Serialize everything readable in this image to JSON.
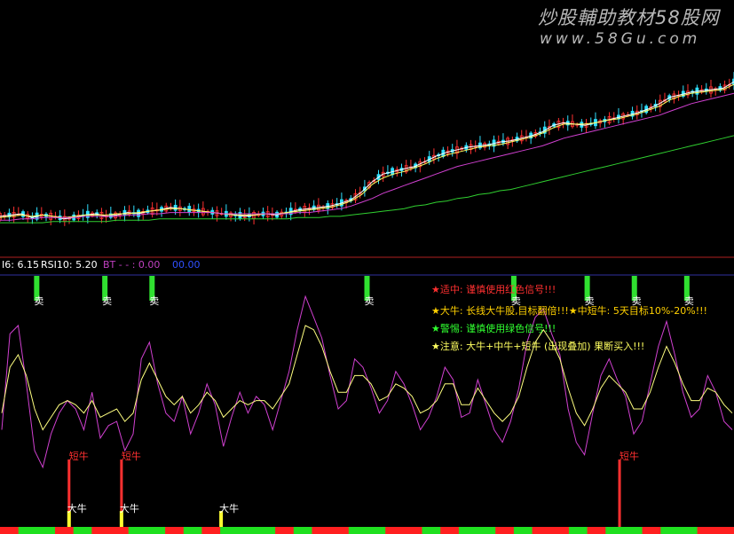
{
  "watermark": {
    "title": "炒股輔助教材58股网",
    "url": "www.58Gu.com"
  },
  "indicator_bar": {
    "segments": [
      {
        "text": "I6: 6.15",
        "color": "#ffffff"
      },
      {
        "text": "RSI10: 5.20",
        "color": "#ffffff"
      },
      {
        "text": "BT - - : 0.00",
        "color": "#c040c0"
      },
      {
        "text": "00.00",
        "color": "#3050ff"
      }
    ]
  },
  "legend": [
    {
      "text": "★适中: 谨慎使用红色信号!!!",
      "color": "#ff3030",
      "star": "#ff3030"
    },
    {
      "text": "★大牛: 长线大牛股,目标翻倍!!!★中短牛: 5天目标10%-20%!!!",
      "color": "#ffd000",
      "star": "#ff9020"
    },
    {
      "text": "★警惕: 谨慎使用绿色信号!!!",
      "color": "#30ff30",
      "star": "#30ff30"
    },
    {
      "text": "★注意: 大牛+中牛+短牛 (出现叠加) 果断买入!!!",
      "color": "#ffff60",
      "star": "#ffff60"
    }
  ],
  "labels": {
    "sell": "卖",
    "short_bull": "短牛",
    "big_bull": "大牛"
  },
  "colors": {
    "candle_up": "#ff3030",
    "candle_down": "#30e0ff",
    "ma_short": "#ffffff",
    "ma_mid": "#ffff60",
    "ma_long": "#d040d0",
    "ma_trend": "#30d030",
    "rsi_fast": "#d040d0",
    "rsi_slow": "#ffff80",
    "sell_bar": "#30e030",
    "short_bull_bar": "#ff3030",
    "big_bull_bar": "#ffff30",
    "strip_red": "#ff2020",
    "strip_green": "#20e020"
  },
  "chart_data": [
    {
      "type": "line",
      "series": [
        {
          "values": [
            45,
            46,
            47,
            44,
            46,
            45,
            43,
            44,
            46,
            47,
            45,
            46,
            48,
            47,
            49,
            50,
            52,
            51,
            50,
            49,
            48,
            47,
            46,
            45,
            46,
            47,
            46,
            48,
            50,
            51,
            52,
            53,
            55,
            58,
            64,
            72,
            78,
            80,
            82,
            84,
            88,
            92,
            95,
            97,
            99,
            100,
            101,
            103,
            104,
            106,
            108,
            111,
            116,
            118,
            117,
            116,
            118,
            120,
            122,
            124,
            126,
            129,
            133,
            138,
            140,
            142,
            143,
            144,
            145,
            150
          ]
        },
        {
          "values": [
            44,
            45,
            46,
            45,
            46,
            45,
            44,
            45,
            46,
            46,
            46,
            47,
            47,
            48,
            49,
            50,
            51,
            51,
            50,
            49,
            48,
            47,
            46,
            46,
            46,
            47,
            47,
            48,
            49,
            50,
            51,
            52,
            54,
            57,
            62,
            70,
            75,
            78,
            80,
            83,
            86,
            90,
            93,
            95,
            97,
            99,
            100,
            101,
            103,
            105,
            107,
            110,
            114,
            117,
            117,
            117,
            118,
            120,
            121,
            123,
            125,
            128,
            131,
            136,
            139,
            141,
            142,
            143,
            144,
            148
          ]
        },
        {
          "values": [
            42,
            42,
            43,
            43,
            44,
            44,
            44,
            44,
            45,
            45,
            45,
            45,
            46,
            46,
            47,
            47,
            48,
            48,
            48,
            48,
            48,
            47,
            47,
            47,
            47,
            47,
            47,
            47,
            48,
            48,
            49,
            50,
            51,
            53,
            56,
            59,
            63,
            66,
            69,
            72,
            75,
            78,
            81,
            84,
            86,
            88,
            90,
            92,
            94,
            96,
            98,
            100,
            103,
            106,
            108,
            110,
            112,
            114,
            116,
            118,
            120,
            122,
            124,
            127,
            130,
            133,
            135,
            137,
            139,
            141
          ]
        },
        {
          "values": [
            40,
            40,
            40,
            40,
            40,
            41,
            41,
            41,
            41,
            41,
            41,
            42,
            42,
            42,
            42,
            43,
            43,
            43,
            43,
            43,
            43,
            43,
            43,
            43,
            43,
            43,
            43,
            43,
            44,
            44,
            44,
            45,
            45,
            46,
            47,
            48,
            49,
            50,
            51,
            53,
            54,
            56,
            57,
            59,
            60,
            62,
            63,
            65,
            66,
            68,
            70,
            72,
            74,
            76,
            78,
            80,
            82,
            84,
            86,
            88,
            90,
            92,
            94,
            96,
            98,
            100,
            102,
            104,
            106,
            108
          ]
        }
      ]
    },
    {
      "type": "line",
      "ylim": [
        0,
        100
      ],
      "series": [
        {
          "values": [
            30,
            76,
            80,
            52,
            20,
            12,
            28,
            38,
            44,
            40,
            30,
            48,
            26,
            32,
            34,
            20,
            28,
            64,
            72,
            52,
            38,
            34,
            46,
            28,
            38,
            52,
            42,
            22,
            36,
            48,
            38,
            46,
            42,
            30,
            44,
            58,
            78,
            94,
            84,
            74,
            56,
            40,
            44,
            64,
            60,
            50,
            38,
            44,
            58,
            52,
            42,
            30,
            36,
            46,
            60,
            54,
            36,
            38,
            54,
            42,
            30,
            24,
            34,
            50,
            72,
            84,
            88,
            76,
            66,
            40,
            24,
            18,
            38,
            56,
            64,
            54,
            46,
            28,
            34,
            52,
            70,
            82,
            66,
            48,
            36,
            40,
            56,
            48,
            34,
            30
          ]
        },
        {
          "values": [
            38,
            60,
            66,
            56,
            40,
            30,
            36,
            42,
            44,
            42,
            38,
            44,
            36,
            38,
            40,
            34,
            38,
            54,
            62,
            54,
            46,
            42,
            46,
            38,
            42,
            48,
            44,
            36,
            40,
            44,
            42,
            44,
            44,
            40,
            46,
            52,
            66,
            80,
            78,
            70,
            58,
            48,
            48,
            56,
            56,
            52,
            44,
            46,
            52,
            50,
            46,
            38,
            40,
            44,
            52,
            52,
            42,
            42,
            50,
            44,
            38,
            34,
            38,
            46,
            60,
            72,
            78,
            72,
            64,
            50,
            38,
            32,
            40,
            50,
            56,
            52,
            48,
            40,
            40,
            48,
            60,
            70,
            62,
            52,
            44,
            44,
            50,
            48,
            42,
            38
          ]
        }
      ],
      "sell_signals": [
        7,
        20,
        29,
        70,
        98,
        112,
        121,
        131
      ],
      "short_bull_signals": [
        13,
        23,
        118
      ],
      "big_bull_signals": [
        13,
        23,
        42
      ]
    }
  ]
}
